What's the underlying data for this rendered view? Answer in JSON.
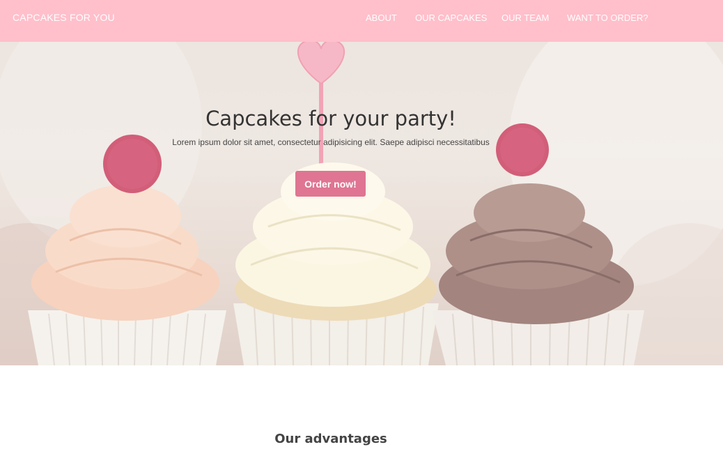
{
  "navbar": {
    "brand": "CAPCAKES FOR YOU",
    "links": [
      "ABOUT",
      "OUR CAPCAKES",
      "OUR TEAM",
      "WANT TO ORDER?"
    ]
  },
  "hero": {
    "title": "Capcakes for your party!",
    "subtitle": "Lorem ipsum dolor sit amet, consectetur adipisicing elit. Saepe adipisci necessitatibus",
    "button_label": "Order now!"
  },
  "advantages": {
    "title": "Our advantages"
  },
  "colors": {
    "navbar_bg": "#ffbfcb",
    "button_bg": "#df7592",
    "text_dark": "#333333"
  }
}
